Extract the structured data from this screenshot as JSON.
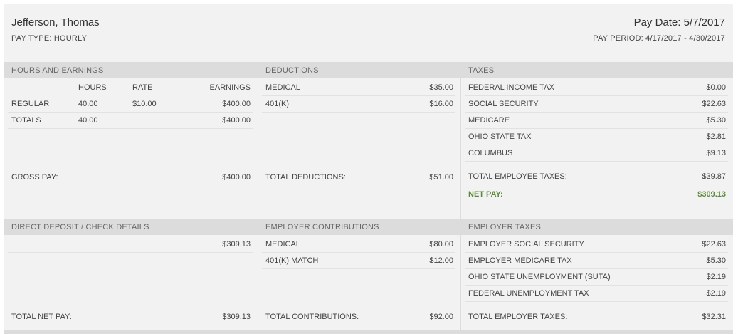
{
  "header": {
    "employee_name": "Jefferson, Thomas",
    "pay_type": "PAY TYPE: HOURLY",
    "pay_date": "Pay Date: 5/7/2017",
    "pay_period": "PAY PERIOD: 4/17/2017 - 4/30/2017"
  },
  "hours_earnings": {
    "title": "HOURS AND EARNINGS",
    "columns": {
      "hours": "HOURS",
      "rate": "RATE",
      "earnings": "EARNINGS"
    },
    "rows": [
      {
        "label": "REGULAR",
        "hours": "40.00",
        "rate": "$10.00",
        "earnings": "$400.00"
      },
      {
        "label": "TOTALS",
        "hours": "40.00",
        "rate": "",
        "earnings": "$400.00"
      }
    ],
    "gross_label": "GROSS PAY:",
    "gross_value": "$400.00"
  },
  "deductions": {
    "title": "DEDUCTIONS",
    "rows": [
      {
        "label": "MEDICAL",
        "value": "$35.00"
      },
      {
        "label": "401(K)",
        "value": "$16.00"
      }
    ],
    "total_label": "TOTAL DEDUCTIONS:",
    "total_value": "$51.00"
  },
  "taxes": {
    "title": "TAXES",
    "rows": [
      {
        "label": "FEDERAL INCOME TAX",
        "value": "$0.00"
      },
      {
        "label": "SOCIAL SECURITY",
        "value": "$22.63"
      },
      {
        "label": "MEDICARE",
        "value": "$5.30"
      },
      {
        "label": "OHIO STATE TAX",
        "value": "$2.81"
      },
      {
        "label": "COLUMBUS",
        "value": "$9.13"
      }
    ],
    "total_label": "TOTAL EMPLOYEE TAXES:",
    "total_value": "$39.87",
    "net_label": "NET PAY:",
    "net_value": "$309.13"
  },
  "direct_deposit": {
    "title": "DIRECT DEPOSIT / CHECK DETAILS",
    "amount": "$309.13",
    "total_label": "TOTAL NET PAY:",
    "total_value": "$309.13"
  },
  "employer_contributions": {
    "title": "EMPLOYER CONTRIBUTIONS",
    "rows": [
      {
        "label": "MEDICAL",
        "value": "$80.00"
      },
      {
        "label": "401(K) MATCH",
        "value": "$12.00"
      }
    ],
    "total_label": "TOTAL CONTRIBUTIONS:",
    "total_value": "$92.00"
  },
  "employer_taxes": {
    "title": "EMPLOYER TAXES",
    "rows": [
      {
        "label": "EMPLOYER SOCIAL SECURITY",
        "value": "$22.63"
      },
      {
        "label": "EMPLOYER MEDICARE TAX",
        "value": "$5.30"
      },
      {
        "label": "OHIO STATE UNEMPLOYMENT (SUTA)",
        "value": "$2.19"
      },
      {
        "label": "FEDERAL UNEMPLOYMENT TAX",
        "value": "$2.19"
      }
    ],
    "total_label": "TOTAL EMPLOYER TAXES:",
    "total_value": "$32.31"
  },
  "colors": {
    "band": "#dcdcdc",
    "background": "#f2f2f2",
    "net_pay": "#5b8a3b"
  }
}
